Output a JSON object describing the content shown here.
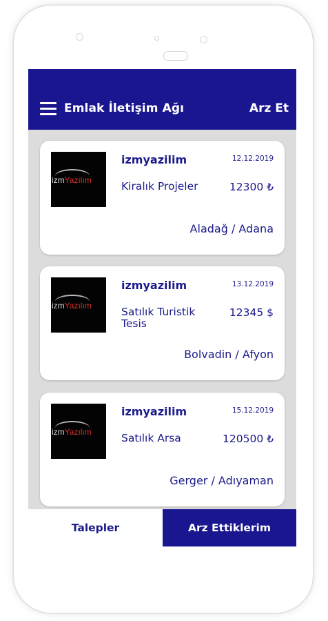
{
  "app_bar": {
    "title": "Emlak İletişim Ağı",
    "action_label": "Arz Et",
    "menu_icon": "hamburger-menu-icon"
  },
  "listings": [
    {
      "user": "izmyazilim",
      "date": "12.12.2019",
      "title": "Kiralık Projeler",
      "price": "12300 ₺",
      "location": "Aladağ / Adana",
      "logo_left": "izm",
      "logo_right": "Yazılım"
    },
    {
      "user": "izmyazilim",
      "date": "13.12.2019",
      "title": "Satılık Turistik Tesis",
      "price": "12345 $",
      "location": "Bolvadin / Afyon",
      "logo_left": "izm",
      "logo_right": "Yazılım"
    },
    {
      "user": "izmyazilim",
      "date": "15.12.2019",
      "title": "Satılık Arsa",
      "price": "120500 ₺",
      "location": "Gerger / Adıyaman",
      "logo_left": "izm",
      "logo_right": "Yazılım"
    }
  ],
  "bottom_tabs": [
    {
      "label": "Talepler",
      "active": false
    },
    {
      "label": "Arz Ettiklerim",
      "active": true
    }
  ],
  "colors": {
    "primary": "#1a1690",
    "text": "#1b1b8b",
    "background": "#dcdcdc",
    "logo_red": "#d8302a"
  }
}
